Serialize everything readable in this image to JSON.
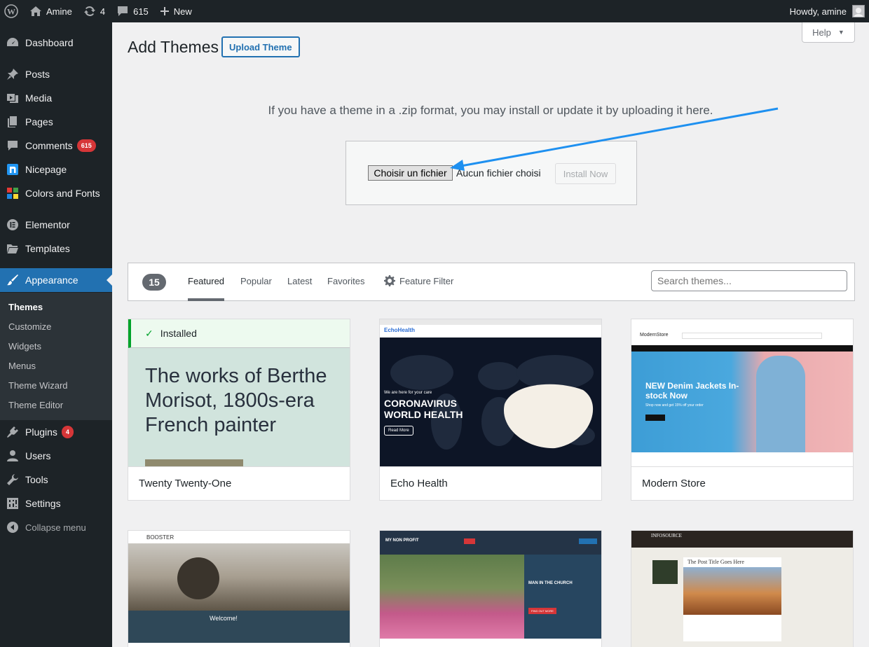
{
  "adminbar": {
    "site_name": "Amine",
    "updates_count": "4",
    "comments_count": "615",
    "new_label": "New",
    "howdy": "Howdy, amine"
  },
  "sidebar": {
    "items": [
      {
        "label": "Dashboard",
        "icon": "dashboard-icon"
      },
      {
        "label": "Posts",
        "icon": "pin-icon"
      },
      {
        "label": "Media",
        "icon": "media-icon"
      },
      {
        "label": "Pages",
        "icon": "pages-icon"
      },
      {
        "label": "Comments",
        "icon": "comment-icon",
        "badge": "615"
      },
      {
        "label": "Nicepage",
        "icon": "nicepage-icon"
      },
      {
        "label": "Colors and Fonts",
        "icon": "palette-icon"
      },
      {
        "label": "Elementor",
        "icon": "elementor-icon"
      },
      {
        "label": "Templates",
        "icon": "folder-icon"
      },
      {
        "label": "Appearance",
        "icon": "brush-icon"
      },
      {
        "label": "Plugins",
        "icon": "plugin-icon",
        "badge": "4"
      },
      {
        "label": "Users",
        "icon": "users-icon"
      },
      {
        "label": "Tools",
        "icon": "wrench-icon"
      },
      {
        "label": "Settings",
        "icon": "settings-icon"
      },
      {
        "label": "Collapse menu",
        "icon": "collapse-icon"
      }
    ],
    "submenu": [
      "Themes",
      "Customize",
      "Widgets",
      "Menus",
      "Theme Wizard",
      "Theme Editor"
    ]
  },
  "page": {
    "title": "Add Themes",
    "upload_button": "Upload Theme",
    "help": "Help",
    "upload_help": "If you have a theme in a .zip format, you may install or update it by uploading it here.",
    "file_button": "Choisir un fichier",
    "file_status": "Aucun fichier choisi",
    "install_button": "Install Now"
  },
  "filter": {
    "count": "15",
    "tabs": [
      "Featured",
      "Popular",
      "Latest",
      "Favorites"
    ],
    "feature_filter": "Feature Filter",
    "search_placeholder": "Search themes..."
  },
  "themes": [
    {
      "name": "Twenty Twenty-One",
      "installed_label": "Installed",
      "headline": "The works of Berthe Morisot, 1800s-era French painter"
    },
    {
      "name": "Echo Health",
      "headline": "CORONAVIRUS WORLD HEALTH",
      "kicker": "We are here for your care",
      "button": "Read More",
      "logo": "EchoHealth"
    },
    {
      "name": "Modern Store",
      "headline": "NEW Denim Jackets In-stock Now",
      "sub": "Shop now and get 15% off your order",
      "logo": "ModernStore"
    },
    {
      "name": "",
      "logo": "BOOSTER",
      "welcome": "Welcome!"
    },
    {
      "name": "",
      "logo": "MY NON PROFIT",
      "headline": "MAN IN THE CHURCH",
      "button": "FIND OUT MORE"
    },
    {
      "name": "",
      "logo": "INFOSOURCE",
      "headline": "The Post Title Goes Here"
    }
  ],
  "colors": {
    "admin_dark": "#1d2327",
    "accent": "#2271b1",
    "badge": "#d63638",
    "installed": "#00a32a",
    "annotation_arrow": "#1e90f0"
  }
}
